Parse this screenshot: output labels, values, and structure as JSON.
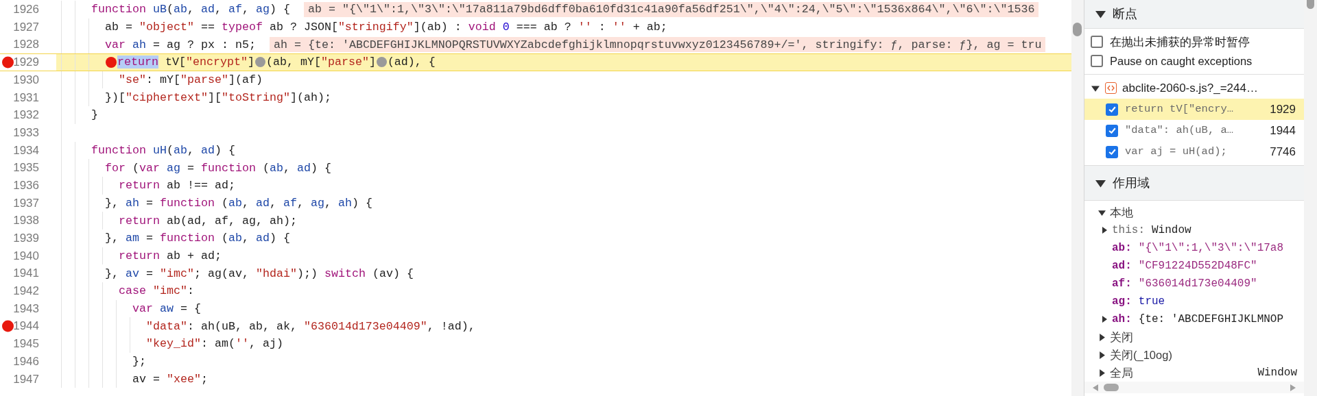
{
  "code": {
    "lines": [
      {
        "number": "1926",
        "breakpoint": false,
        "current": false,
        "tokens": [
          {
            "kind": "keyword",
            "text": "    function"
          },
          {
            "kind": "definition",
            "text": " uB"
          },
          {
            "kind": "plain",
            "text": "("
          },
          {
            "kind": "definition",
            "text": "ab"
          },
          {
            "kind": "plain",
            "text": ", "
          },
          {
            "kind": "definition",
            "text": "ad"
          },
          {
            "kind": "plain",
            "text": ", "
          },
          {
            "kind": "definition",
            "text": "af"
          },
          {
            "kind": "plain",
            "text": ", "
          },
          {
            "kind": "definition",
            "text": "ag"
          },
          {
            "kind": "plain",
            "text": ") {"
          }
        ],
        "inline_value": "ab = \"{\\\"1\\\":1,\\\"3\\\":\\\"17a811a79bd6dff0ba610fd31c41a90fa56df251\\\",\\\"4\\\":24,\\\"5\\\":\\\"1536x864\\\",\\\"6\\\":\\\"1536"
      },
      {
        "number": "1927",
        "breakpoint": false,
        "current": false,
        "tokens": [
          {
            "kind": "plain",
            "text": "      ab = "
          },
          {
            "kind": "string",
            "text": "\"object\""
          },
          {
            "kind": "plain",
            "text": " == "
          },
          {
            "kind": "keyword",
            "text": "typeof"
          },
          {
            "kind": "plain",
            "text": " ab ? JSON["
          },
          {
            "kind": "string",
            "text": "\"stringify\""
          },
          {
            "kind": "plain",
            "text": "](ab) : "
          },
          {
            "kind": "keyword",
            "text": "void"
          },
          {
            "kind": "number",
            "text": " 0"
          },
          {
            "kind": "plain",
            "text": " === ab ? "
          },
          {
            "kind": "string",
            "text": "''"
          },
          {
            "kind": "plain",
            "text": " : "
          },
          {
            "kind": "string",
            "text": "''"
          },
          {
            "kind": "plain",
            "text": " + ab;"
          }
        ]
      },
      {
        "number": "1928",
        "breakpoint": false,
        "current": false,
        "tokens": [
          {
            "kind": "keyword",
            "text": "      var"
          },
          {
            "kind": "definition",
            "text": " ah"
          },
          {
            "kind": "plain",
            "text": " = ag ? px : n5;"
          }
        ],
        "inline_value": "ah = {te: 'ABCDEFGHIJKLMNOPQRSTUVWXYZabcdefghijklmnopqrstuvwxyz0123456789+/=', stringify: ƒ, parse: ƒ}, ag = tru"
      },
      {
        "number": "1929",
        "breakpoint": true,
        "current": true,
        "tokens": [
          {
            "kind": "breakpoint-dot",
            "active": true
          },
          {
            "kind": "selected-keyword",
            "text": "      return"
          },
          {
            "kind": "plain",
            "text": " tV["
          },
          {
            "kind": "string",
            "text": "\"encrypt\""
          },
          {
            "kind": "plain",
            "text": "]"
          },
          {
            "kind": "breakpoint-dot",
            "active": false
          },
          {
            "kind": "plain",
            "text": "(ab, mY["
          },
          {
            "kind": "string",
            "text": "\"parse\""
          },
          {
            "kind": "plain",
            "text": "]"
          },
          {
            "kind": "breakpoint-dot",
            "active": false
          },
          {
            "kind": "plain",
            "text": "(ad), {"
          }
        ]
      },
      {
        "number": "1930",
        "breakpoint": false,
        "current": false,
        "tokens": [
          {
            "kind": "string",
            "text": "        \"se\""
          },
          {
            "kind": "plain",
            "text": ": mY["
          },
          {
            "kind": "string",
            "text": "\"parse\""
          },
          {
            "kind": "plain",
            "text": "](af)"
          }
        ]
      },
      {
        "number": "1931",
        "breakpoint": false,
        "current": false,
        "tokens": [
          {
            "kind": "plain",
            "text": "      })["
          },
          {
            "kind": "string",
            "text": "\"ciphertext\""
          },
          {
            "kind": "plain",
            "text": "]["
          },
          {
            "kind": "string",
            "text": "\"toString\""
          },
          {
            "kind": "plain",
            "text": "](ah);"
          }
        ]
      },
      {
        "number": "1932",
        "breakpoint": false,
        "current": false,
        "tokens": [
          {
            "kind": "plain",
            "text": "    }"
          }
        ]
      },
      {
        "number": "1933",
        "breakpoint": false,
        "current": false
      },
      {
        "number": "1934",
        "breakpoint": false,
        "current": false,
        "tokens": [
          {
            "kind": "keyword",
            "text": "    function"
          },
          {
            "kind": "definition",
            "text": " uH"
          },
          {
            "kind": "plain",
            "text": "("
          },
          {
            "kind": "definition",
            "text": "ab"
          },
          {
            "kind": "plain",
            "text": ", "
          },
          {
            "kind": "definition",
            "text": "ad"
          },
          {
            "kind": "plain",
            "text": ") {"
          }
        ]
      },
      {
        "number": "1935",
        "breakpoint": false,
        "current": false,
        "tokens": [
          {
            "kind": "keyword",
            "text": "      for"
          },
          {
            "kind": "plain",
            "text": " ("
          },
          {
            "kind": "keyword",
            "text": "var"
          },
          {
            "kind": "definition",
            "text": " ag"
          },
          {
            "kind": "plain",
            "text": " = "
          },
          {
            "kind": "keyword",
            "text": "function"
          },
          {
            "kind": "plain",
            "text": " ("
          },
          {
            "kind": "definition",
            "text": "ab"
          },
          {
            "kind": "plain",
            "text": ", "
          },
          {
            "kind": "definition",
            "text": "ad"
          },
          {
            "kind": "plain",
            "text": ") {"
          }
        ]
      },
      {
        "number": "1936",
        "breakpoint": false,
        "current": false,
        "tokens": [
          {
            "kind": "keyword",
            "text": "        return"
          },
          {
            "kind": "plain",
            "text": " ab !== ad;"
          }
        ]
      },
      {
        "number": "1937",
        "breakpoint": false,
        "current": false,
        "tokens": [
          {
            "kind": "plain",
            "text": "      }, "
          },
          {
            "kind": "definition",
            "text": "ah"
          },
          {
            "kind": "plain",
            "text": " = "
          },
          {
            "kind": "keyword",
            "text": "function"
          },
          {
            "kind": "plain",
            "text": " ("
          },
          {
            "kind": "definition",
            "text": "ab"
          },
          {
            "kind": "plain",
            "text": ", "
          },
          {
            "kind": "definition",
            "text": "ad"
          },
          {
            "kind": "plain",
            "text": ", "
          },
          {
            "kind": "definition",
            "text": "af"
          },
          {
            "kind": "plain",
            "text": ", "
          },
          {
            "kind": "definition",
            "text": "ag"
          },
          {
            "kind": "plain",
            "text": ", "
          },
          {
            "kind": "definition",
            "text": "ah"
          },
          {
            "kind": "plain",
            "text": ") {"
          }
        ]
      },
      {
        "number": "1938",
        "breakpoint": false,
        "current": false,
        "tokens": [
          {
            "kind": "keyword",
            "text": "        return"
          },
          {
            "kind": "plain",
            "text": " ab(ad, af, ag, ah);"
          }
        ]
      },
      {
        "number": "1939",
        "breakpoint": false,
        "current": false,
        "tokens": [
          {
            "kind": "plain",
            "text": "      }, "
          },
          {
            "kind": "definition",
            "text": "am"
          },
          {
            "kind": "plain",
            "text": " = "
          },
          {
            "kind": "keyword",
            "text": "function"
          },
          {
            "kind": "plain",
            "text": " ("
          },
          {
            "kind": "definition",
            "text": "ab"
          },
          {
            "kind": "plain",
            "text": ", "
          },
          {
            "kind": "definition",
            "text": "ad"
          },
          {
            "kind": "plain",
            "text": ") {"
          }
        ]
      },
      {
        "number": "1940",
        "breakpoint": false,
        "current": false,
        "tokens": [
          {
            "kind": "keyword",
            "text": "        return"
          },
          {
            "kind": "plain",
            "text": " ab + ad;"
          }
        ]
      },
      {
        "number": "1941",
        "breakpoint": false,
        "current": false,
        "tokens": [
          {
            "kind": "plain",
            "text": "      }, "
          },
          {
            "kind": "definition",
            "text": "av"
          },
          {
            "kind": "plain",
            "text": " = "
          },
          {
            "kind": "string",
            "text": "\"imc\""
          },
          {
            "kind": "plain",
            "text": "; ag(av, "
          },
          {
            "kind": "string",
            "text": "\"hdai\""
          },
          {
            "kind": "plain",
            "text": ");) "
          },
          {
            "kind": "keyword",
            "text": "switch"
          },
          {
            "kind": "plain",
            "text": " (av) {"
          }
        ]
      },
      {
        "number": "1942",
        "breakpoint": false,
        "current": false,
        "tokens": [
          {
            "kind": "keyword",
            "text": "        case"
          },
          {
            "kind": "string",
            "text": " \"imc\""
          },
          {
            "kind": "plain",
            "text": ":"
          }
        ]
      },
      {
        "number": "1943",
        "breakpoint": false,
        "current": false,
        "tokens": [
          {
            "kind": "keyword",
            "text": "          var"
          },
          {
            "kind": "definition",
            "text": " aw"
          },
          {
            "kind": "plain",
            "text": " = {"
          }
        ]
      },
      {
        "number": "1944",
        "breakpoint": true,
        "current": false,
        "tokens": [
          {
            "kind": "string",
            "text": "            \"data\""
          },
          {
            "kind": "plain",
            "text": ": ah(uB, ab, ak, "
          },
          {
            "kind": "string",
            "text": "\"636014d173e04409\""
          },
          {
            "kind": "plain",
            "text": ", !ad),"
          }
        ]
      },
      {
        "number": "1945",
        "breakpoint": false,
        "current": false,
        "tokens": [
          {
            "kind": "string",
            "text": "            \"key_id\""
          },
          {
            "kind": "plain",
            "text": ": am("
          },
          {
            "kind": "string",
            "text": "''"
          },
          {
            "kind": "plain",
            "text": ", aj)"
          }
        ]
      },
      {
        "number": "1946",
        "breakpoint": false,
        "current": false,
        "tokens": [
          {
            "kind": "plain",
            "text": "          };"
          }
        ]
      },
      {
        "number": "1947",
        "breakpoint": false,
        "current": false,
        "tokens": [
          {
            "kind": "plain",
            "text": "          av = "
          },
          {
            "kind": "string",
            "text": "\"xee\""
          },
          {
            "kind": "plain",
            "text": ";"
          }
        ]
      }
    ]
  },
  "sidebar": {
    "breakpoints": {
      "title": "断点",
      "expanded": true,
      "options": [
        {
          "label": "在抛出未捕获的异常时暂停",
          "checked": false
        },
        {
          "label": "Pause on caught exceptions",
          "checked": false
        }
      ],
      "file": {
        "name": "abclite-2060-s.js?_=244…",
        "expanded": true
      },
      "items": [
        {
          "code": "return tV[\"encry…",
          "line": "1929",
          "checked": true,
          "selected": true
        },
        {
          "code": "\"data\": ah(uB, a…",
          "line": "1944",
          "checked": true,
          "selected": false
        },
        {
          "code": "var aj = uH(ad);",
          "line": "7746",
          "checked": true,
          "selected": false
        }
      ]
    },
    "scope": {
      "title": "作用域",
      "expanded": true,
      "groups": [
        {
          "label": "本地",
          "expanded": true,
          "variables": [
            {
              "name": "this:",
              "kind": "object",
              "expanded": false,
              "value": "Window"
            },
            {
              "name": "ab:",
              "kind": "string",
              "value": "\"{\\\"1\\\":1,\\\"3\\\":\\\"17a8"
            },
            {
              "name": "ad:",
              "kind": "string",
              "value": "\"CF91224D552D48FC\""
            },
            {
              "name": "af:",
              "kind": "string",
              "value": "\"636014d173e04409\""
            },
            {
              "name": "ag:",
              "kind": "boolean",
              "value": "true"
            },
            {
              "name": "ah:",
              "kind": "object",
              "expanded": false,
              "value": "{te: 'ABCDEFGHIJKLMNOP"
            }
          ]
        },
        {
          "label": "关闭",
          "expanded": false
        },
        {
          "label": "关闭(_10og)",
          "expanded": false
        },
        {
          "label": "全局",
          "expanded": false,
          "value": "Window"
        }
      ]
    }
  }
}
